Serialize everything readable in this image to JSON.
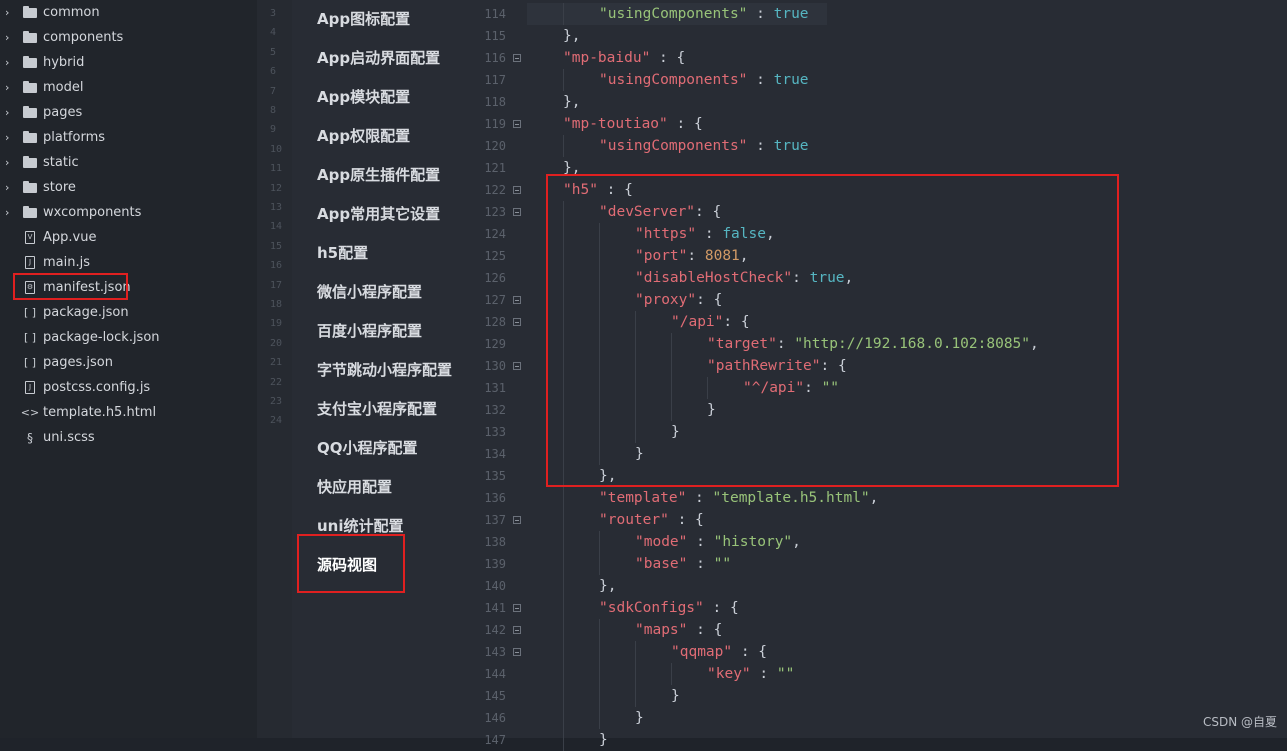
{
  "file_tree": [
    {
      "name": "common",
      "type": "folder"
    },
    {
      "name": "components",
      "type": "folder"
    },
    {
      "name": "hybrid",
      "type": "folder"
    },
    {
      "name": "model",
      "type": "folder"
    },
    {
      "name": "pages",
      "type": "folder"
    },
    {
      "name": "platforms",
      "type": "folder"
    },
    {
      "name": "static",
      "type": "folder"
    },
    {
      "name": "store",
      "type": "folder"
    },
    {
      "name": "wxcomponents",
      "type": "folder"
    },
    {
      "name": "App.vue",
      "type": "vue"
    },
    {
      "name": "main.js",
      "type": "js"
    },
    {
      "name": "manifest.json",
      "type": "manifest",
      "highlighted": true
    },
    {
      "name": "package.json",
      "type": "json"
    },
    {
      "name": "package-lock.json",
      "type": "json"
    },
    {
      "name": "pages.json",
      "type": "json"
    },
    {
      "name": "postcss.config.js",
      "type": "js"
    },
    {
      "name": "template.h5.html",
      "type": "html"
    },
    {
      "name": "uni.scss",
      "type": "scss"
    }
  ],
  "icons": {
    "folder": "folder-icon",
    "vue": "vue-file-icon",
    "js": "js-file-icon",
    "json": "json-file-icon",
    "manifest": "manifest-gear-icon",
    "html": "html-file-icon",
    "scss": "scss-file-icon",
    "chevron": "chevron-right-icon"
  },
  "strip_numbers": [
    "3",
    "4",
    "5",
    "6",
    "7",
    "8",
    "9",
    "10",
    "11",
    "12",
    "13",
    "14",
    "15",
    "16",
    "17",
    "18",
    "19",
    "20",
    "21",
    "22",
    "23",
    "24"
  ],
  "config_menu": [
    "App图标配置",
    "App启动界面配置",
    "App模块配置",
    "App权限配置",
    "App原生插件配置",
    "App常用其它设置",
    "h5配置",
    "微信小程序配置",
    "百度小程序配置",
    "字节跳动小程序配置",
    "支付宝小程序配置",
    "QQ小程序配置",
    "快应用配置",
    "uni统计配置",
    "源码视图"
  ],
  "active_menu": "源码视图",
  "code_lines": [
    {
      "n": "114",
      "fold": false,
      "indent": 2,
      "tokens": [
        [
          "s",
          "\"usingComponents\""
        ],
        [
          "p",
          " : "
        ],
        [
          "b",
          "true"
        ]
      ]
    },
    {
      "n": "115",
      "fold": false,
      "indent": 1,
      "tokens": [
        [
          "p",
          "},"
        ]
      ]
    },
    {
      "n": "116",
      "fold": true,
      "indent": 1,
      "tokens": [
        [
          "k",
          "\"mp-baidu\""
        ],
        [
          "p",
          " : {"
        ]
      ]
    },
    {
      "n": "117",
      "fold": false,
      "indent": 2,
      "tokens": [
        [
          "k",
          "\"usingComponents\""
        ],
        [
          "p",
          " : "
        ],
        [
          "b",
          "true"
        ]
      ]
    },
    {
      "n": "118",
      "fold": false,
      "indent": 1,
      "tokens": [
        [
          "p",
          "},"
        ]
      ]
    },
    {
      "n": "119",
      "fold": true,
      "indent": 1,
      "tokens": [
        [
          "k",
          "\"mp-toutiao\""
        ],
        [
          "p",
          " : {"
        ]
      ]
    },
    {
      "n": "120",
      "fold": false,
      "indent": 2,
      "tokens": [
        [
          "k",
          "\"usingComponents\""
        ],
        [
          "p",
          " : "
        ],
        [
          "b",
          "true"
        ]
      ]
    },
    {
      "n": "121",
      "fold": false,
      "indent": 1,
      "tokens": [
        [
          "p",
          "},"
        ]
      ]
    },
    {
      "n": "122",
      "fold": true,
      "indent": 1,
      "tokens": [
        [
          "k",
          "\"h5\""
        ],
        [
          "p",
          " : {"
        ]
      ]
    },
    {
      "n": "123",
      "fold": true,
      "indent": 2,
      "tokens": [
        [
          "k",
          "\"devServer\""
        ],
        [
          "p",
          ": {"
        ]
      ]
    },
    {
      "n": "124",
      "fold": false,
      "indent": 3,
      "tokens": [
        [
          "k",
          "\"https\""
        ],
        [
          "p",
          " : "
        ],
        [
          "b",
          "false"
        ],
        [
          "p",
          ","
        ]
      ]
    },
    {
      "n": "125",
      "fold": false,
      "indent": 3,
      "tokens": [
        [
          "k",
          "\"port\""
        ],
        [
          "p",
          ": "
        ],
        [
          "n",
          "8081"
        ],
        [
          "p",
          ","
        ]
      ]
    },
    {
      "n": "126",
      "fold": false,
      "indent": 3,
      "tokens": [
        [
          "k",
          "\"disableHostCheck\""
        ],
        [
          "p",
          ": "
        ],
        [
          "b",
          "true"
        ],
        [
          "p",
          ","
        ]
      ]
    },
    {
      "n": "127",
      "fold": true,
      "indent": 3,
      "tokens": [
        [
          "k",
          "\"proxy\""
        ],
        [
          "p",
          ": {"
        ]
      ]
    },
    {
      "n": "128",
      "fold": true,
      "indent": 4,
      "tokens": [
        [
          "k",
          "\"/api\""
        ],
        [
          "p",
          ": {"
        ]
      ]
    },
    {
      "n": "129",
      "fold": false,
      "indent": 5,
      "tokens": [
        [
          "k",
          "\"target\""
        ],
        [
          "p",
          ": "
        ],
        [
          "s",
          "\"http://192.168.0.102:8085\""
        ],
        [
          "p",
          ","
        ]
      ]
    },
    {
      "n": "130",
      "fold": true,
      "indent": 5,
      "tokens": [
        [
          "k",
          "\"pathRewrite\""
        ],
        [
          "p",
          ": {"
        ]
      ]
    },
    {
      "n": "131",
      "fold": false,
      "indent": 6,
      "tokens": [
        [
          "k",
          "\"^/api\""
        ],
        [
          "p",
          ": "
        ],
        [
          "s",
          "\"\""
        ]
      ]
    },
    {
      "n": "132",
      "fold": false,
      "indent": 5,
      "tokens": [
        [
          "p",
          "}"
        ]
      ]
    },
    {
      "n": "133",
      "fold": false,
      "indent": 4,
      "tokens": [
        [
          "p",
          "}"
        ]
      ]
    },
    {
      "n": "134",
      "fold": false,
      "indent": 3,
      "tokens": [
        [
          "p",
          "}"
        ]
      ]
    },
    {
      "n": "135",
      "fold": false,
      "indent": 2,
      "tokens": [
        [
          "p",
          "},"
        ]
      ]
    },
    {
      "n": "136",
      "fold": false,
      "indent": 2,
      "tokens": [
        [
          "k",
          "\"template\""
        ],
        [
          "p",
          " : "
        ],
        [
          "s",
          "\"template.h5.html\""
        ],
        [
          "p",
          ","
        ]
      ]
    },
    {
      "n": "137",
      "fold": true,
      "indent": 2,
      "tokens": [
        [
          "k",
          "\"router\""
        ],
        [
          "p",
          " : {"
        ]
      ]
    },
    {
      "n": "138",
      "fold": false,
      "indent": 3,
      "tokens": [
        [
          "k",
          "\"mode\""
        ],
        [
          "p",
          " : "
        ],
        [
          "s",
          "\"history\""
        ],
        [
          "p",
          ","
        ]
      ]
    },
    {
      "n": "139",
      "fold": false,
      "indent": 3,
      "tokens": [
        [
          "k",
          "\"base\""
        ],
        [
          "p",
          " : "
        ],
        [
          "s",
          "\"\""
        ]
      ]
    },
    {
      "n": "140",
      "fold": false,
      "indent": 2,
      "tokens": [
        [
          "p",
          "},"
        ]
      ]
    },
    {
      "n": "141",
      "fold": true,
      "indent": 2,
      "tokens": [
        [
          "k",
          "\"sdkConfigs\""
        ],
        [
          "p",
          " : {"
        ]
      ]
    },
    {
      "n": "142",
      "fold": true,
      "indent": 3,
      "tokens": [
        [
          "k",
          "\"maps\""
        ],
        [
          "p",
          " : {"
        ]
      ]
    },
    {
      "n": "143",
      "fold": true,
      "indent": 4,
      "tokens": [
        [
          "k",
          "\"qqmap\""
        ],
        [
          "p",
          " : {"
        ]
      ]
    },
    {
      "n": "144",
      "fold": false,
      "indent": 5,
      "tokens": [
        [
          "k",
          "\"key\""
        ],
        [
          "p",
          " : "
        ],
        [
          "s",
          "\"\""
        ]
      ]
    },
    {
      "n": "145",
      "fold": false,
      "indent": 4,
      "tokens": [
        [
          "p",
          "}"
        ]
      ]
    },
    {
      "n": "146",
      "fold": false,
      "indent": 3,
      "tokens": [
        [
          "p",
          "}"
        ]
      ]
    },
    {
      "n": "147",
      "fold": false,
      "indent": 2,
      "tokens": [
        [
          "p",
          "}"
        ]
      ]
    }
  ],
  "watermark": "CSDN @自夏",
  "colors": {
    "highlight_box": "#e02020",
    "key": "#e06c75",
    "string": "#98c379",
    "boolean": "#56b6c2",
    "number": "#d19a66"
  }
}
